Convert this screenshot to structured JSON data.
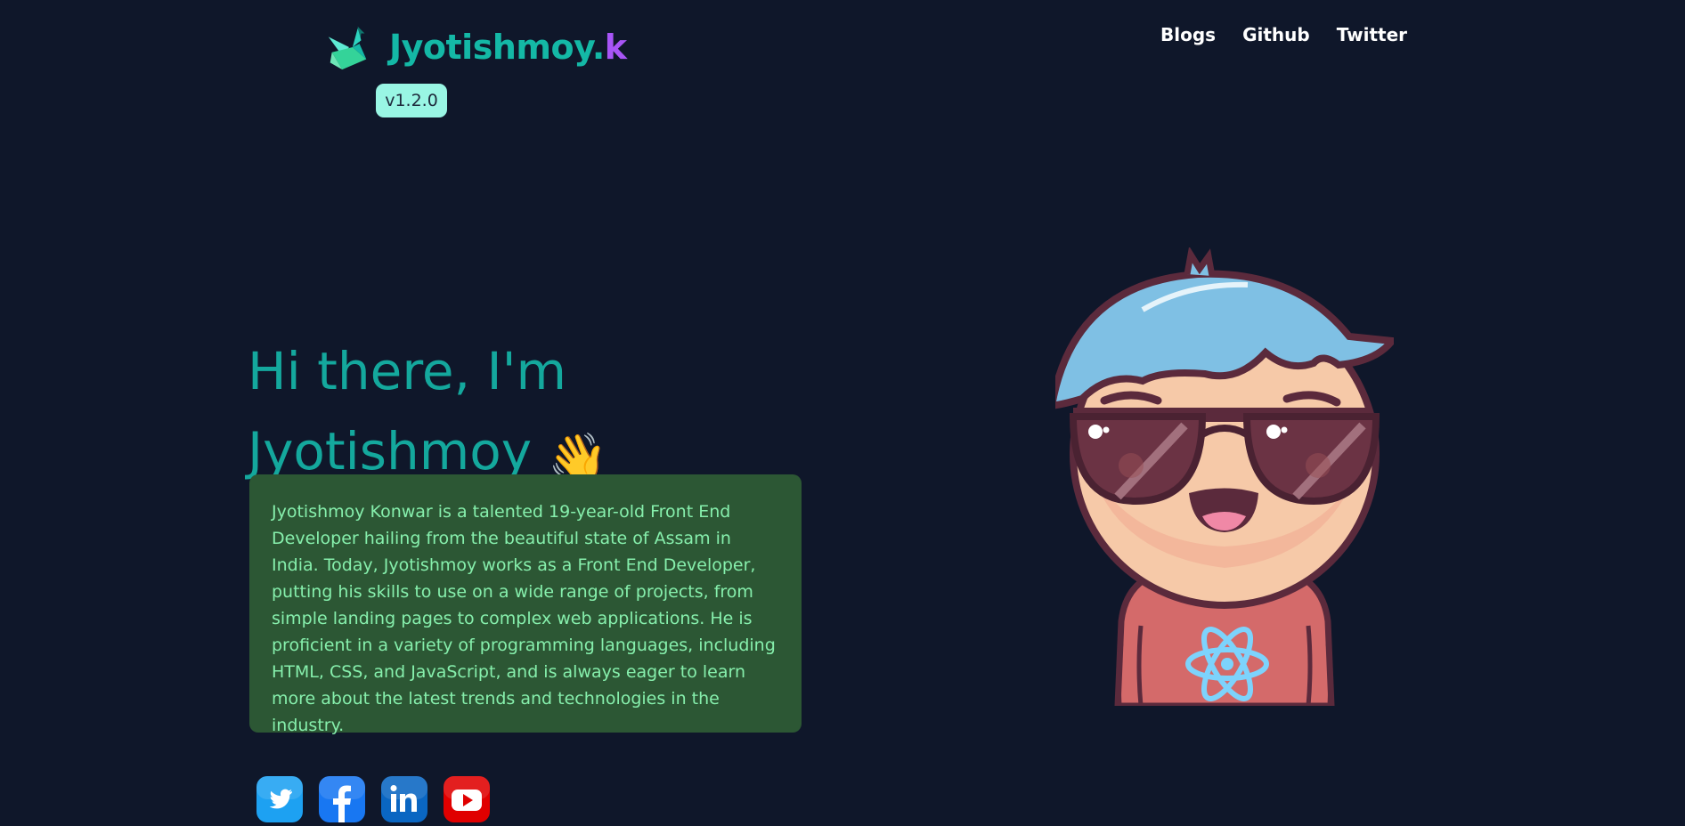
{
  "header": {
    "brand_main": "Jyotishmoy.",
    "brand_accent": "k",
    "version": "v1.2.0",
    "logo_icon": "origami-bird-icon",
    "nav": [
      {
        "label": "Blogs"
      },
      {
        "label": "Github"
      },
      {
        "label": "Twitter"
      }
    ]
  },
  "hero": {
    "line1": "Hi there, I'm",
    "line2": "Jyotishmoy",
    "wave_emoji": "👋",
    "bio": "Jyotishmoy Konwar is a talented 19-year-old Front End Developer hailing from the beautiful state of Assam in India. Today, Jyotishmoy works as a Front End Developer, putting his skills to use on a wide range of projects, from simple landing pages to complex web applications. He is proficient in a variety of programming languages, including HTML, CSS, and JavaScript, and is always eager to learn more about the latest trends and technologies in the industry."
  },
  "socials": [
    {
      "icon": "twitter-icon",
      "color": "#1da1f2"
    },
    {
      "icon": "facebook-icon",
      "color": "#1877f2"
    },
    {
      "icon": "linkedin-icon",
      "color": "#0a66c2"
    },
    {
      "icon": "youtube-icon",
      "color": "#e00000"
    }
  ],
  "illustration": {
    "icon": "developer-avatar-illustration"
  },
  "colors": {
    "background": "#0f172a",
    "accent_teal": "#14b8a6",
    "accent_purple": "#a855f7",
    "bio_bg": "#2c5734",
    "bio_text": "#86efac",
    "version_bg": "#99f6e4"
  }
}
